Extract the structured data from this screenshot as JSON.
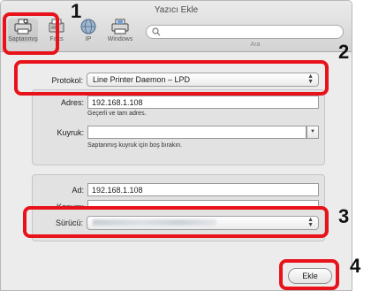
{
  "window": {
    "title": "Yazıcı Ekle"
  },
  "toolbar": {
    "items": [
      {
        "label": "Saptanmış",
        "icon": "printer-icon"
      },
      {
        "label": "Faks",
        "icon": "fax-icon"
      },
      {
        "label": "IP",
        "icon": "globe-icon"
      },
      {
        "label": "Windows",
        "icon": "windows-printer-icon"
      }
    ],
    "search_label": "Ara",
    "search_value": ""
  },
  "form": {
    "protocol_label": "Protokol:",
    "protocol_value": "Line Printer Daemon – LPD",
    "address_label": "Adres:",
    "address_value": "192.168.1.108",
    "address_hint": "Geçerli ve tam adres.",
    "queue_label": "Kuyruk:",
    "queue_value": "",
    "queue_hint": "Saptanmış kuyruk için boş bırakın.",
    "name_label": "Ad:",
    "name_value": "192.168.1.108",
    "location_label": "Konum:",
    "location_value": "",
    "driver_label": "Sürücü:",
    "driver_value": ""
  },
  "buttons": {
    "add_label": "Ekle"
  },
  "annotations": {
    "step1": "1",
    "step2": "2",
    "step3": "3",
    "step4": "4",
    "color": "#e8121a"
  }
}
